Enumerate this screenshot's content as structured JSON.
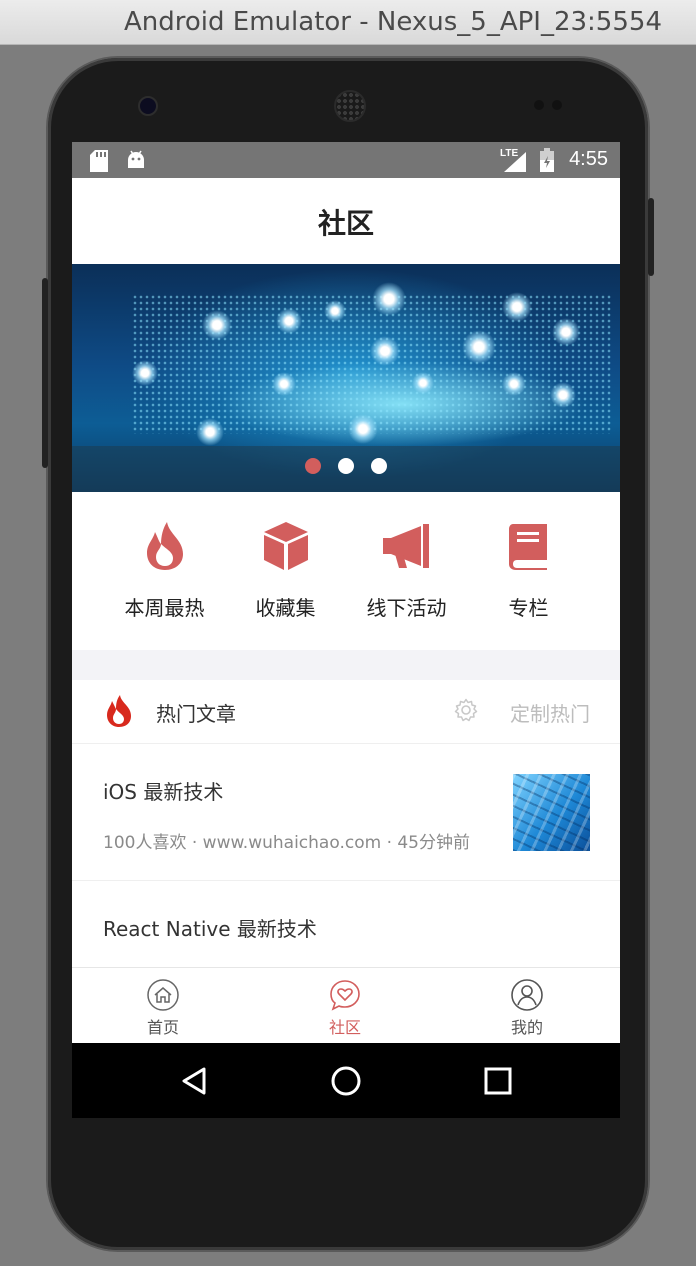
{
  "window": {
    "title": "Android Emulator - Nexus_5_API_23:5554"
  },
  "statusbar": {
    "network": "LTE",
    "time": "4:55",
    "left_icons": [
      "sd-card-icon",
      "android-icon"
    ],
    "right_icons": [
      "lte-signal-icon",
      "battery-icon"
    ]
  },
  "header": {
    "title": "社区"
  },
  "banner": {
    "slides": 3,
    "active_index": 0
  },
  "menu": {
    "items": [
      {
        "label": "本周最热",
        "icon": "fire-icon"
      },
      {
        "label": "收藏集",
        "icon": "box-icon"
      },
      {
        "label": "线下活动",
        "icon": "megaphone-icon"
      },
      {
        "label": "专栏",
        "icon": "book-icon"
      }
    ]
  },
  "hot_section": {
    "title": "热门文章",
    "customize_label": "定制热门",
    "icon": "fire-icon",
    "settings_icon": "gear-icon"
  },
  "articles": [
    {
      "title": "iOS 最新技术",
      "meta": "100人喜欢 · www.wuhaichao.com · 45分钟前"
    },
    {
      "title": "React Native 最新技术",
      "meta": ""
    }
  ],
  "tabbar": {
    "items": [
      {
        "label": "首页",
        "icon": "home-icon"
      },
      {
        "label": "社区",
        "icon": "community-heart-icon"
      },
      {
        "label": "我的",
        "icon": "profile-icon"
      }
    ],
    "active_index": 1
  },
  "system_nav": {
    "buttons": [
      "back-icon",
      "home-circle-icon",
      "recents-icon"
    ]
  },
  "colors": {
    "accent": "#d25e5d",
    "statusbar": "#757575",
    "section_gap": "#f3f3f7",
    "muted_text": "#8a8a8a"
  }
}
